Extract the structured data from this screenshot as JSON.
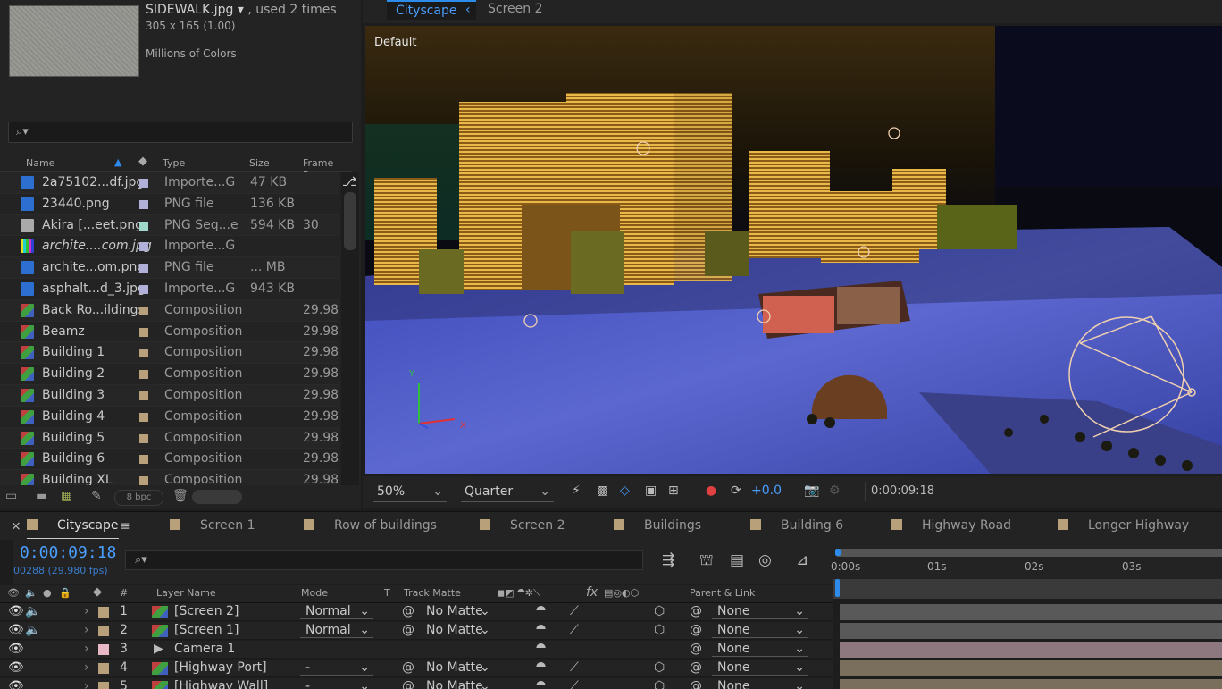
{
  "project": {
    "file_name": "SIDEWALK.jpg",
    "file_arrow": "▾",
    "used_times": ", used 2 times",
    "dimensions": "305 x 165 (1.00)",
    "color_depth": "Millions of Colors",
    "search_icon": "search-icon",
    "search_icon_glyph": "⌕▾",
    "columns": {
      "name": "Name",
      "type": "Type",
      "size": "Size",
      "frame_rate": "Frame R..."
    },
    "items": [
      {
        "name": "2a75102...df.jpg",
        "type": "Importe...G",
        "size": "47 KB",
        "frame": "",
        "icon": "jpg",
        "tag": "#b0b0d8"
      },
      {
        "name": "23440.png",
        "type": "PNG file",
        "size": "136 KB",
        "frame": "",
        "icon": "jpg",
        "tag": "#b0b0d8"
      },
      {
        "name": "Akira [...eet.png",
        "type": "PNG Seq...e",
        "size": "594 KB",
        "frame": "30",
        "icon": "seq",
        "tag": "#9ed8cc"
      },
      {
        "name": "archite....com.jpg",
        "type": "Importe...G",
        "size": "",
        "frame": "",
        "icon": "missing",
        "tag": "#b0b0d8"
      },
      {
        "name": "archite...om.png",
        "type": "PNG file",
        "size": "... MB",
        "frame": "",
        "icon": "jpg",
        "tag": "#b0b0d8"
      },
      {
        "name": "asphalt...d_3.jpg",
        "type": "Importe...G",
        "size": "943 KB",
        "frame": "",
        "icon": "jpg",
        "tag": "#b0b0d8"
      },
      {
        "name": "Back Ro...ildings",
        "type": "Composition",
        "size": "",
        "frame": "29.98",
        "icon": "comp",
        "tag": "#b8a07a"
      },
      {
        "name": "Beamz",
        "type": "Composition",
        "size": "",
        "frame": "29.98",
        "icon": "comp",
        "tag": "#b8a07a"
      },
      {
        "name": "Building 1",
        "type": "Composition",
        "size": "",
        "frame": "29.98",
        "icon": "comp",
        "tag": "#b8a07a"
      },
      {
        "name": "Building 2",
        "type": "Composition",
        "size": "",
        "frame": "29.98",
        "icon": "comp",
        "tag": "#b8a07a"
      },
      {
        "name": "Building 3",
        "type": "Composition",
        "size": "",
        "frame": "29.98",
        "icon": "comp",
        "tag": "#b8a07a"
      },
      {
        "name": "Building 4",
        "type": "Composition",
        "size": "",
        "frame": "29.98",
        "icon": "comp",
        "tag": "#b8a07a"
      },
      {
        "name": "Building 5",
        "type": "Composition",
        "size": "",
        "frame": "29.98",
        "icon": "comp",
        "tag": "#b8a07a"
      },
      {
        "name": "Building 6",
        "type": "Composition",
        "size": "",
        "frame": "29.98",
        "icon": "comp",
        "tag": "#b8a07a"
      },
      {
        "name": "Building XL",
        "type": "Composition",
        "size": "",
        "frame": "29.98",
        "icon": "comp",
        "tag": "#b8a07a"
      }
    ],
    "bpc": "8 bpc"
  },
  "viewer": {
    "tab_active": "Cityscape",
    "tab_close": "‹",
    "tab_other": "Screen 2",
    "view_label": "Default",
    "axis_y": "Y",
    "axis_x": "X",
    "zoom": "50%",
    "resolution": "Quarter",
    "exposure": "+0.0",
    "timecode": "0:00:09:18",
    "dd_arrow": "⌄"
  },
  "timeline": {
    "tabs": [
      {
        "label": "Cityscape",
        "color": "#b8a07a"
      },
      {
        "label": "Screen 1",
        "color": "#b8a07a"
      },
      {
        "label": "Row of buildings",
        "color": "#b8a07a"
      },
      {
        "label": "Screen 2",
        "color": "#b8a07a"
      },
      {
        "label": "Buildings",
        "color": "#b8a07a"
      },
      {
        "label": "Building 6",
        "color": "#b8a07a"
      },
      {
        "label": "Highway Road",
        "color": "#b8a07a"
      },
      {
        "label": "Longer Highway",
        "color": "#b8a07a"
      }
    ],
    "close_glyph": "×",
    "menu_glyph": "≡",
    "current_time": "0:00:09:18",
    "current_frame": "00288 (29.980 fps)",
    "search_glyph": "⌕▾",
    "columns": {
      "hash": "#",
      "layer_name": "Layer Name",
      "mode": "Mode",
      "t": "T",
      "track_matte": "Track Matte",
      "fx": "fx",
      "parent": "Parent & Link"
    },
    "ruler": [
      "0:00s",
      "01s",
      "02s",
      "03s"
    ],
    "layers": [
      {
        "num": "1",
        "name": "[Screen 2]",
        "mode": "Normal",
        "matte": "No Matte",
        "parent": "None",
        "color": "#b8a07a",
        "bar": "#595959",
        "icon": "comp"
      },
      {
        "num": "2",
        "name": "[Screen 1]",
        "mode": "Normal",
        "matte": "No Matte",
        "parent": "None",
        "color": "#b8a07a",
        "bar": "#595959",
        "icon": "comp"
      },
      {
        "num": "3",
        "name": "Camera 1",
        "mode": "",
        "matte": "",
        "parent": "None",
        "color": "#e9b8c6",
        "bar": "#8d7880",
        "icon": "camera"
      },
      {
        "num": "4",
        "name": "[Highway Port]",
        "mode": "-",
        "matte": "No Matte",
        "parent": "None",
        "color": "#b8a07a",
        "bar": "#7a6e5c",
        "icon": "comp"
      },
      {
        "num": "5",
        "name": "[Highway Wall]",
        "mode": "-",
        "matte": "No Matte",
        "parent": "None",
        "color": "#b8a07a",
        "bar": "#7a6e5c",
        "icon": "comp"
      }
    ]
  }
}
